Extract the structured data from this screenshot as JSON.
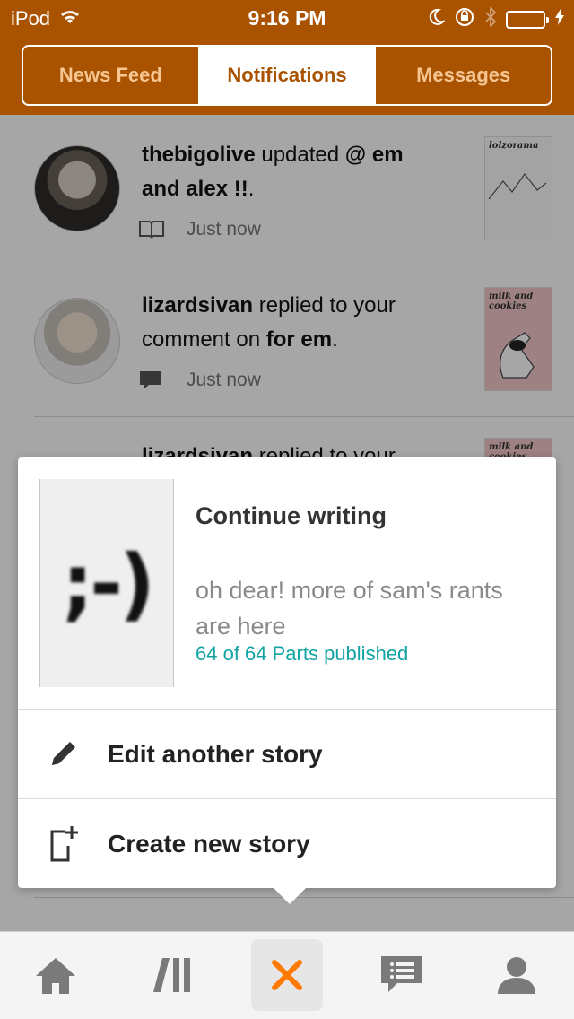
{
  "status": {
    "carrier": "iPod",
    "time": "9:16 PM"
  },
  "tabs": [
    {
      "label": "News Feed"
    },
    {
      "label": "Notifications"
    },
    {
      "label": "Messages"
    }
  ],
  "notifications": [
    {
      "user": "thebigolive",
      "text_a": " updated ",
      "target": "@ em and alex !!",
      "text_b": ".",
      "time": "Just now",
      "thumb_title": "lolzorama"
    },
    {
      "user": "lizardsivan",
      "text_a": " replied to your comment on ",
      "target": "for em",
      "text_b": ".",
      "time": "Just now",
      "thumb_title": "milk and cookies"
    },
    {
      "user": "lizardsivan",
      "text_a": " replied to your",
      "target": "",
      "text_b": "",
      "time": "",
      "thumb_title": "milk and cookies"
    }
  ],
  "popup": {
    "cover_text": ";-)",
    "title": "Continue writing",
    "description": "oh dear! more of sam's rants are here",
    "parts": "64 of 64 Parts published",
    "edit_label": "Edit another story",
    "create_label": "Create new story"
  },
  "tabbar": [
    "home-icon",
    "library-icon",
    "close-icon",
    "messages-icon",
    "profile-icon"
  ],
  "colors": {
    "brand": "#a95200",
    "accent": "#ff8a00",
    "link": "#12a3a3"
  }
}
